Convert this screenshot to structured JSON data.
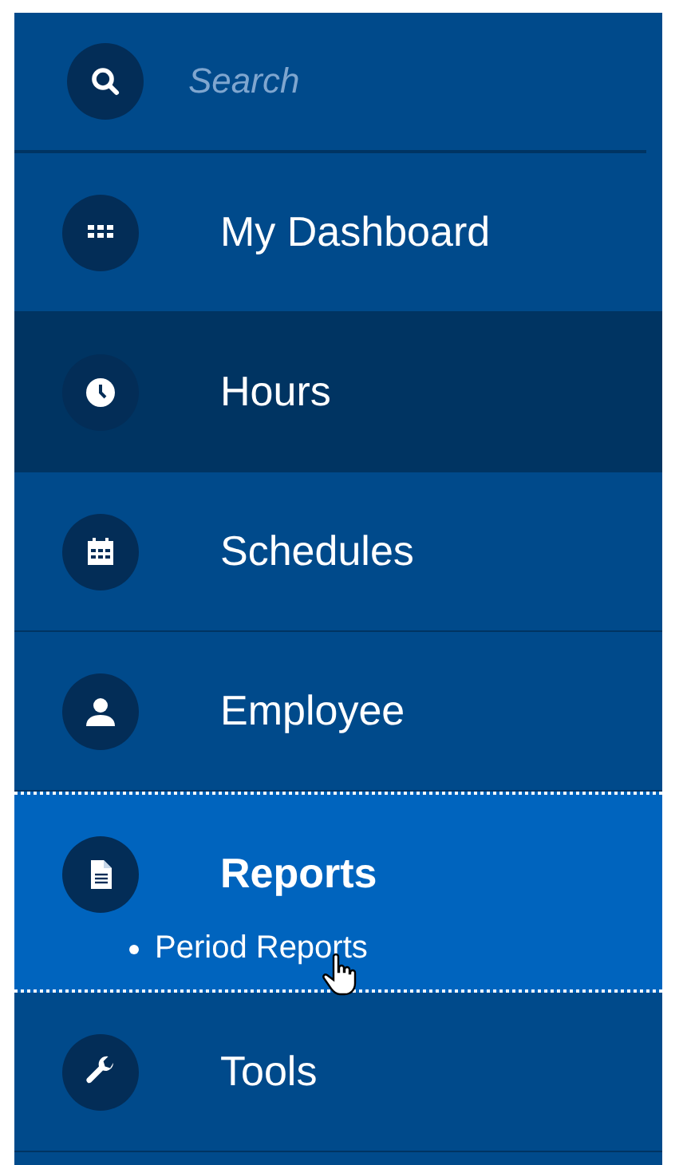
{
  "search": {
    "placeholder": "Search"
  },
  "menu": [
    {
      "label": "My Dashboard",
      "selected": false,
      "highlighted": false
    },
    {
      "label": "Hours",
      "selected": false,
      "highlighted": true
    },
    {
      "label": "Schedules",
      "selected": false,
      "highlighted": false
    },
    {
      "label": "Employee",
      "selected": false,
      "highlighted": false
    },
    {
      "label": "Reports",
      "selected": true,
      "highlighted": false,
      "children": [
        {
          "label": "Period Reports"
        }
      ]
    },
    {
      "label": "Tools",
      "selected": false,
      "highlighted": false
    }
  ]
}
